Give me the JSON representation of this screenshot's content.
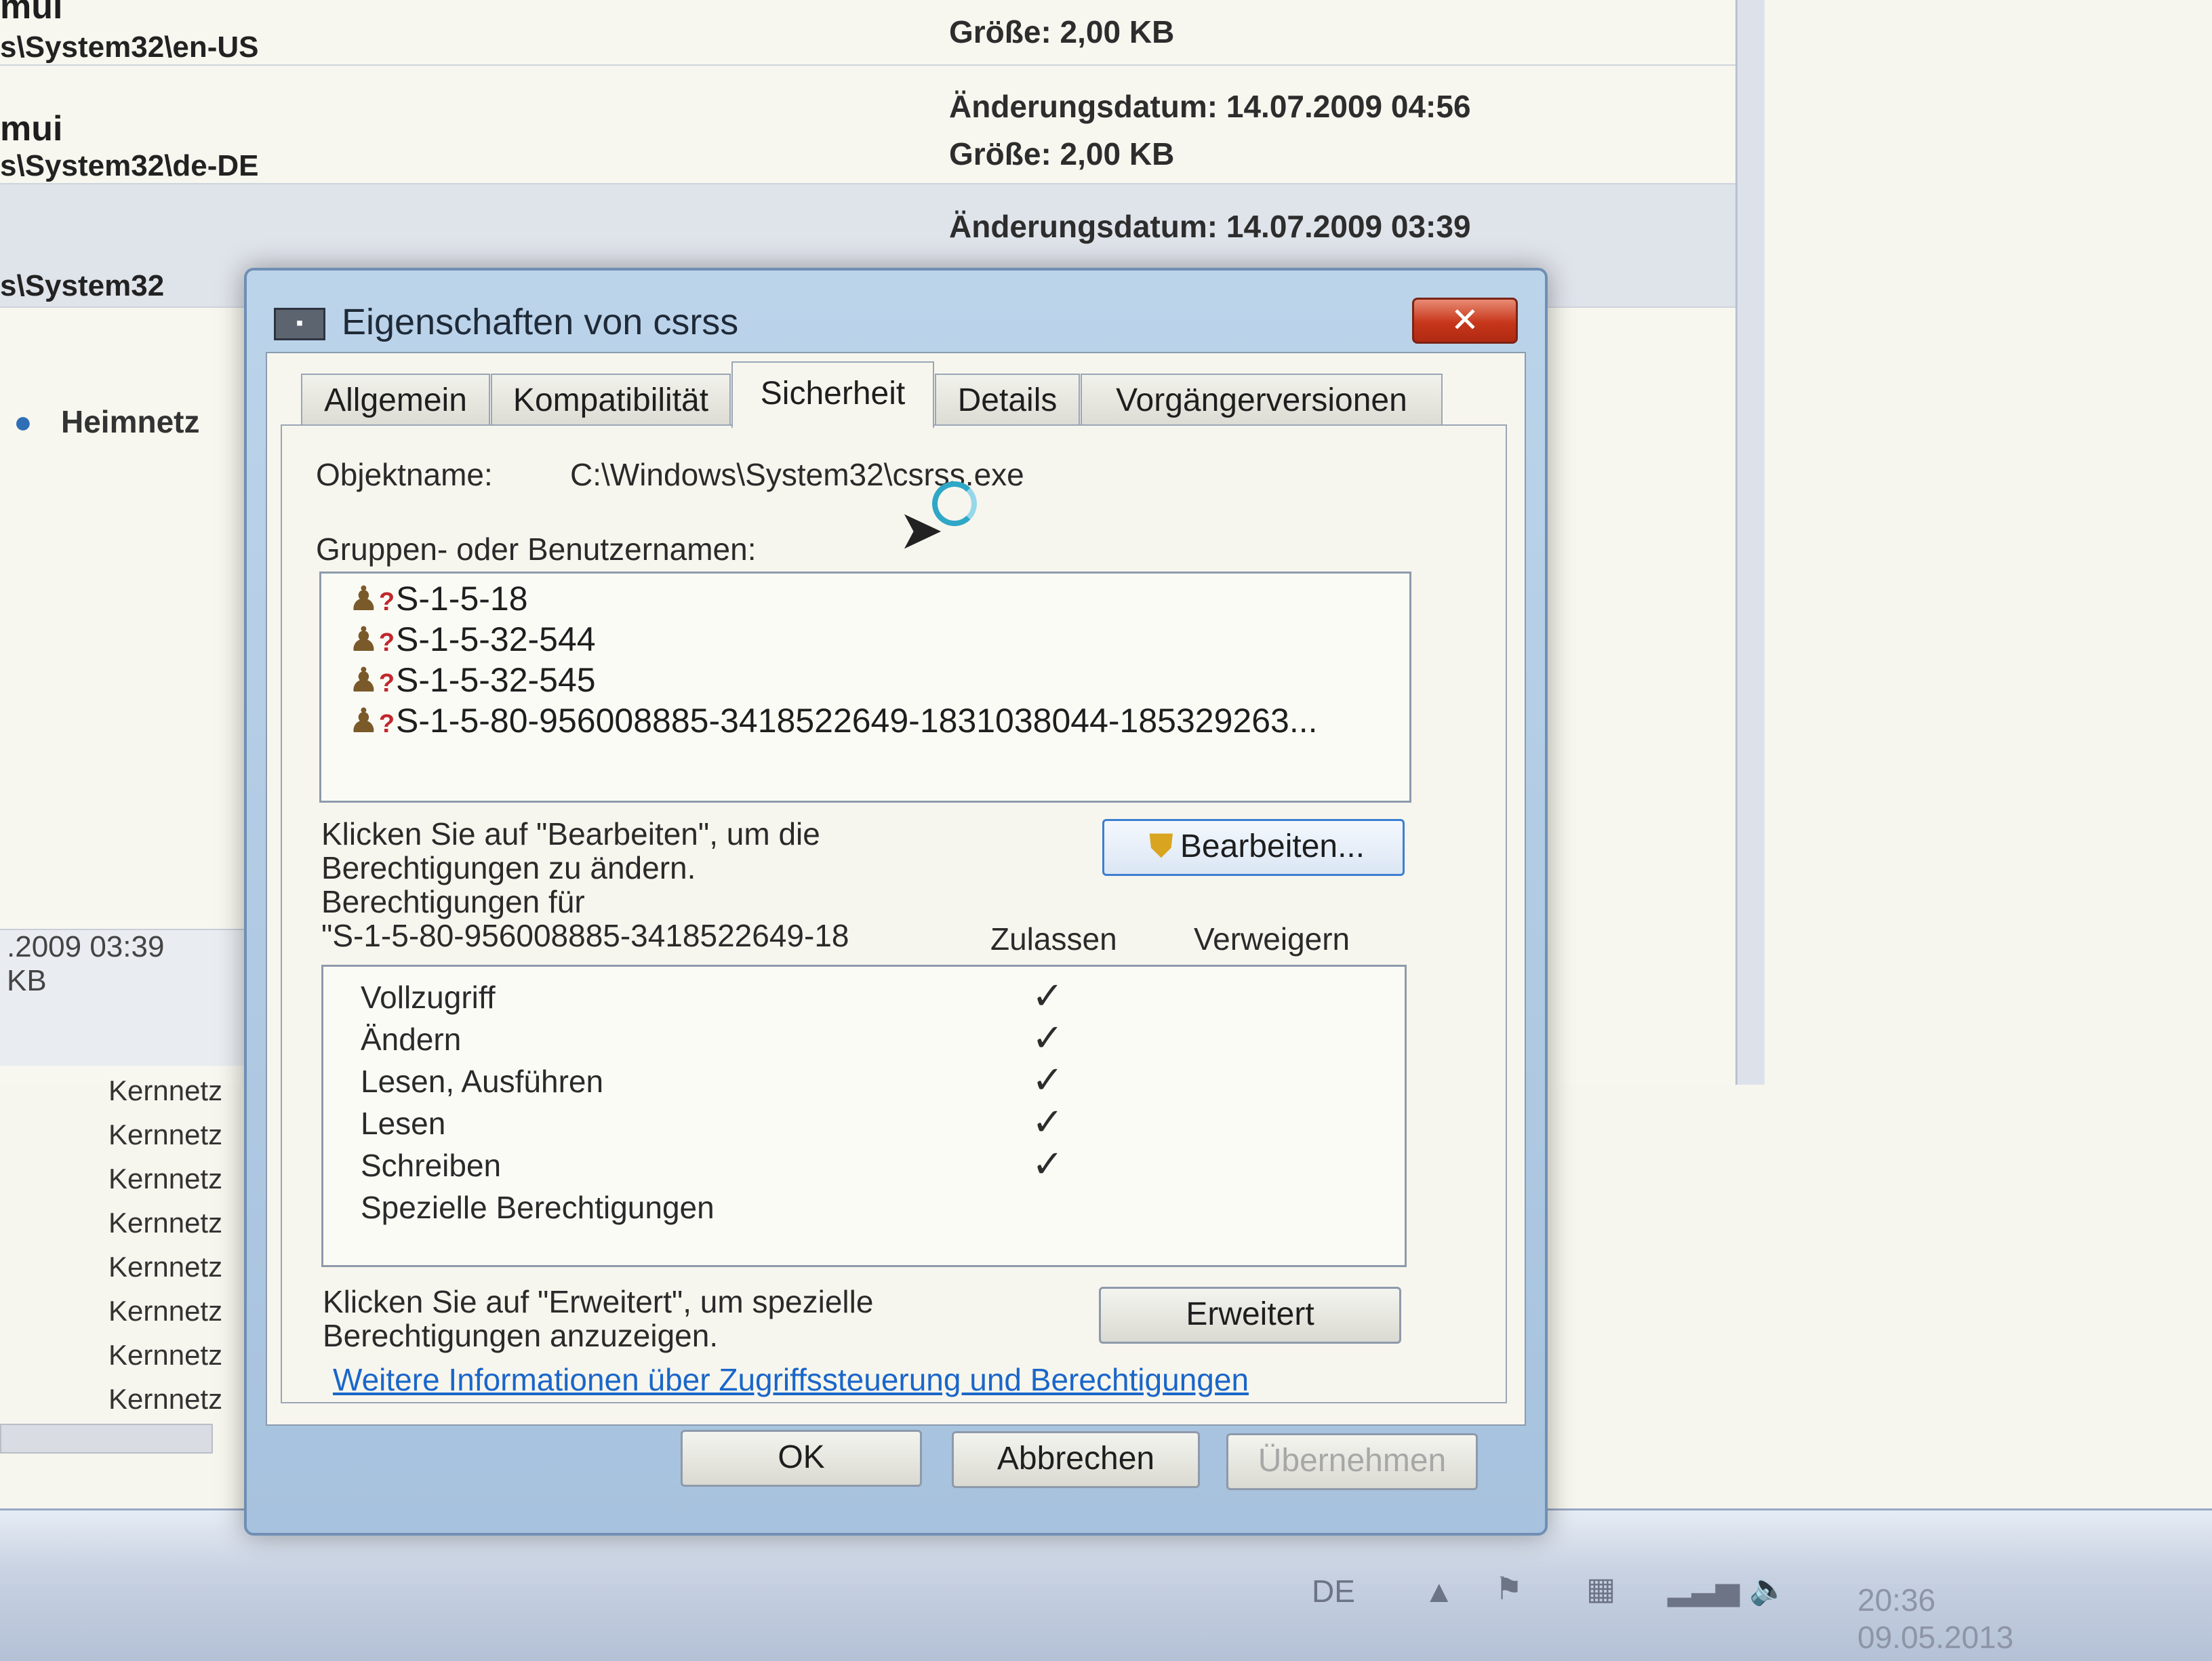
{
  "explorer": {
    "rows": [
      {
        "name": "mui",
        "path": "s\\System32\\en-US",
        "meta_lines": [
          "Größe: 2,00 KB"
        ]
      },
      {
        "name": "mui",
        "path": "s\\System32\\de-DE",
        "meta_lines": [
          "Änderungsdatum: 14.07.2009 04:56",
          "Größe: 2,00 KB"
        ]
      },
      {
        "name": "",
        "path": "s\\System32",
        "meta_lines": [
          "Änderungsdatum: 14.07.2009 03:39"
        ]
      }
    ],
    "nav_item": "Heimnetz",
    "left_info": [
      ".2009 03:39",
      "KB"
    ],
    "kern_items": [
      "Kernnetz",
      "Kernnetz",
      "Kernnetz",
      "Kernnetz",
      "Kernnetz",
      "Kernnetz",
      "Kernnetz",
      "Kernnetz"
    ]
  },
  "dialog": {
    "title": "Eigenschaften von csrss",
    "close_label": "✕",
    "tabs": [
      "Allgemein",
      "Kompatibilität",
      "Sicherheit",
      "Details",
      "Vorgängerversionen"
    ],
    "active_tab": "Sicherheit",
    "object_label": "Objektname:",
    "object_value": "C:\\Windows\\System32\\csrss.exe",
    "groups_label": "Gruppen- oder Benutzernamen:",
    "groups": [
      "S-1-5-18",
      "S-1-5-32-544",
      "S-1-5-32-545",
      "S-1-5-80-956008885-3418522649-1831038044-185329263..."
    ],
    "edit_hint": [
      "Klicken Sie auf \"Bearbeiten\", um die",
      "Berechtigungen zu ändern."
    ],
    "edit_button": "Bearbeiten...",
    "perm_for_label": "Berechtigungen für",
    "perm_for_value": "\"S-1-5-80-956008885-3418522649-18",
    "col_allow": "Zulassen",
    "col_deny": "Verweigern",
    "permissions": [
      {
        "name": "Vollzugriff",
        "allow": true
      },
      {
        "name": "Ändern",
        "allow": true
      },
      {
        "name": "Lesen, Ausführen",
        "allow": true
      },
      {
        "name": "Lesen",
        "allow": true
      },
      {
        "name": "Schreiben",
        "allow": true
      },
      {
        "name": "Spezielle Berechtigungen",
        "allow": false
      }
    ],
    "advanced_hint": [
      "Klicken Sie auf \"Erweitert\", um spezielle",
      "Berechtigungen anzuzeigen."
    ],
    "advanced_button": "Erweitert",
    "more_link": "Weitere Informationen über Zugriffssteuerung und Berechtigungen",
    "ok_button": "OK",
    "cancel_button": "Abbrechen",
    "apply_button": "Übernehmen"
  },
  "taskbar": {
    "language": "DE",
    "time": "20:36",
    "date": "09.05.2013"
  }
}
